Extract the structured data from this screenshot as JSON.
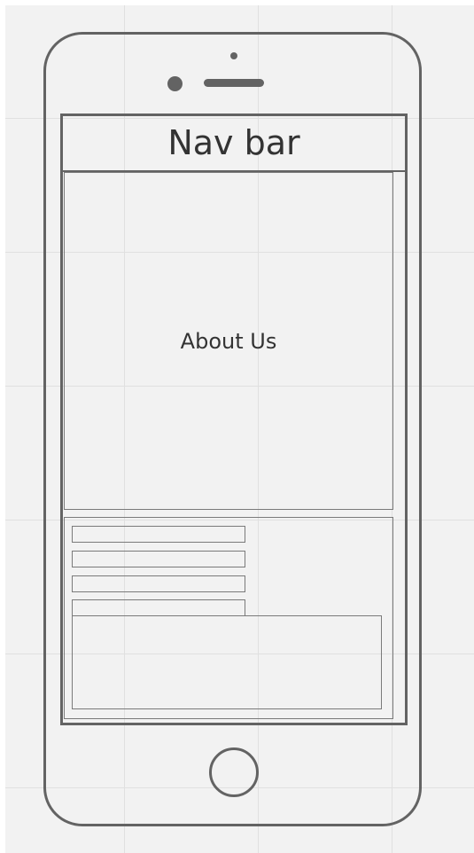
{
  "navbar": {
    "label": "Nav bar"
  },
  "about": {
    "label": "About Us"
  },
  "contact_form": {
    "fields": [
      "",
      "",
      "",
      ""
    ],
    "message": ""
  },
  "icons": {
    "camera": "camera-icon",
    "speaker": "speaker-icon",
    "home_button": "home-button-icon"
  },
  "colors": {
    "canvas": "#f2f2f2",
    "grid": "#e0e0e0",
    "outline": "#636363",
    "thin_outline": "#7a7a7a",
    "text": "#333333"
  }
}
